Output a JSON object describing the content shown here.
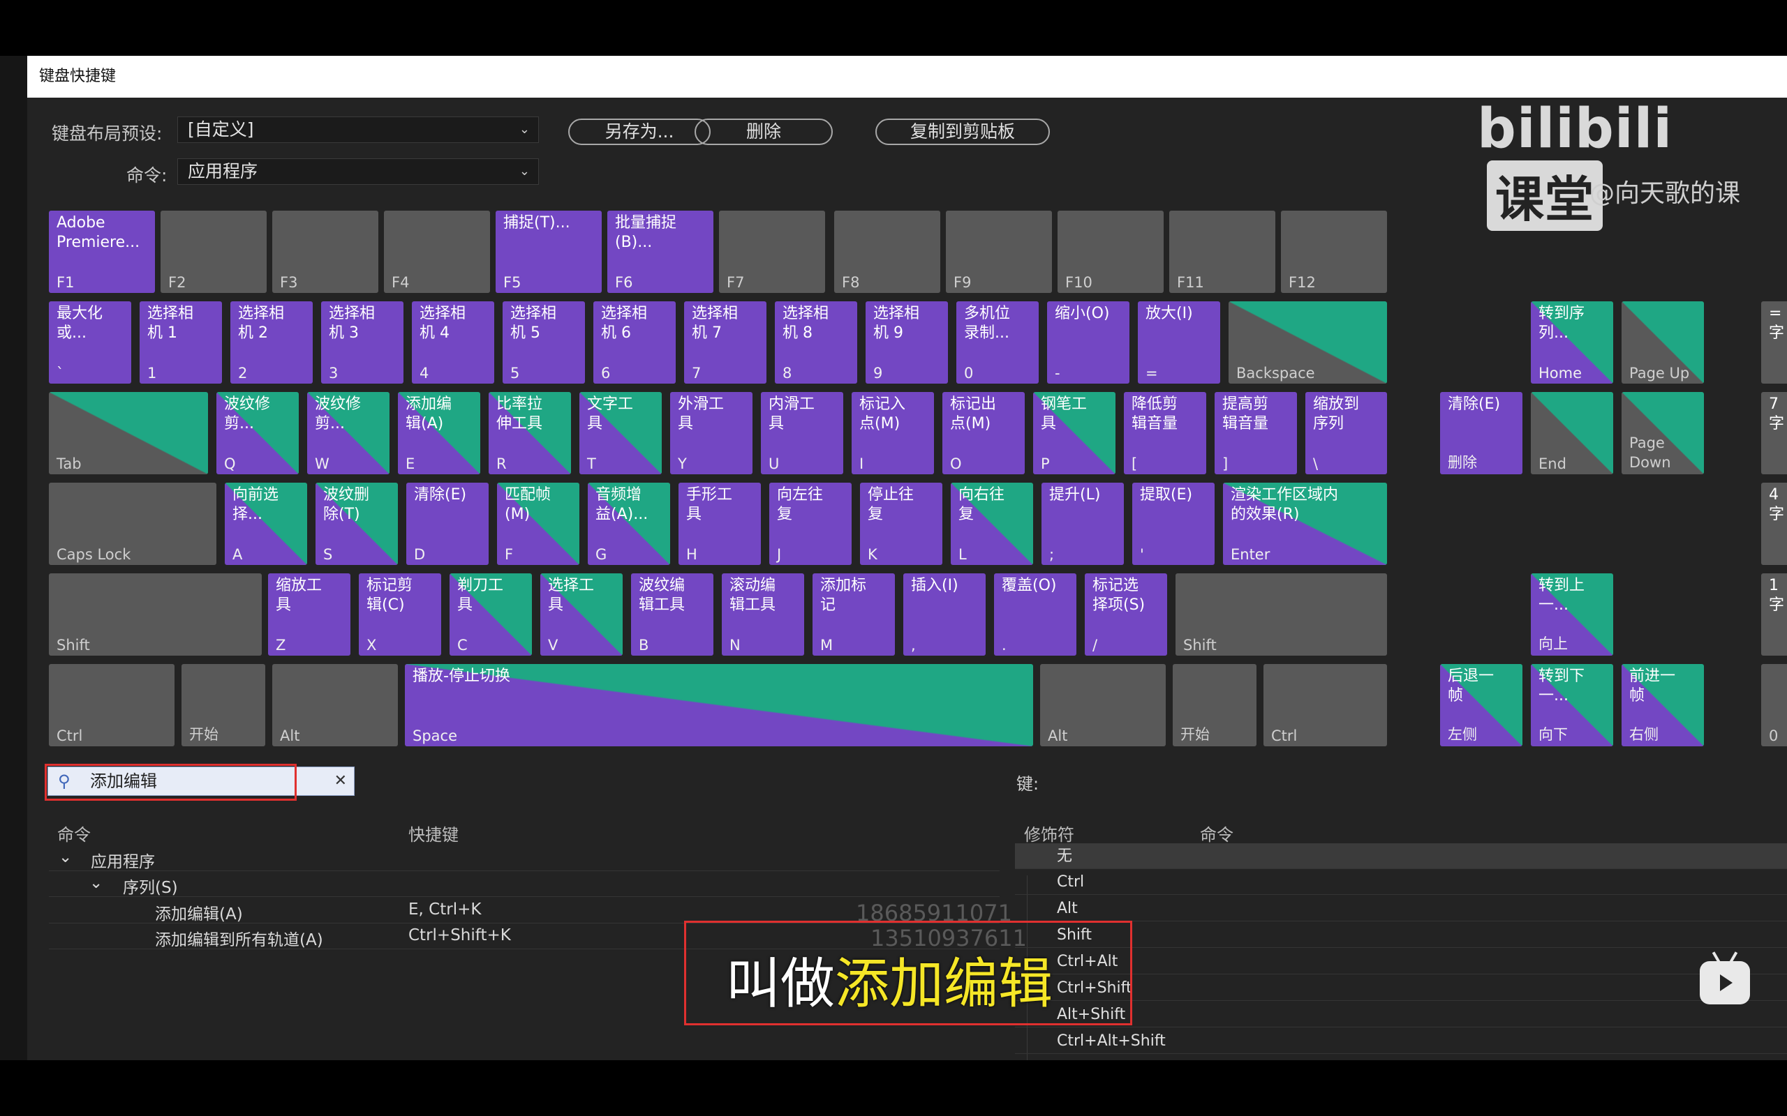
{
  "window_title": "键盘快捷键",
  "preset_label": "键盘布局预设:",
  "preset_value": "[自定义]",
  "command_label": "命令:",
  "command_value": "应用程序",
  "buttons": {
    "save_as": "另存为...",
    "delete": "删除",
    "copy": "复制到剪贴板"
  },
  "watermark": {
    "logo": "bilibili",
    "logo_box": "课堂",
    "user": "@向天歌的课"
  },
  "keys": [
    {
      "id": "f1",
      "type": "app",
      "cmd": "Adobe\nPremiere...",
      "lbl": "F1"
    },
    {
      "id": "f2",
      "type": "none",
      "cmd": "",
      "lbl": "F2"
    },
    {
      "id": "f3",
      "type": "none",
      "cmd": "",
      "lbl": "F3"
    },
    {
      "id": "f4",
      "type": "none",
      "cmd": "",
      "lbl": "F4"
    },
    {
      "id": "f5",
      "type": "app",
      "cmd": "捕捉(T)...",
      "lbl": "F5"
    },
    {
      "id": "f6",
      "type": "app",
      "cmd": "批量捕捉\n(B)...",
      "lbl": "F6"
    },
    {
      "id": "f7",
      "type": "none",
      "cmd": "",
      "lbl": "F7"
    },
    {
      "id": "f8",
      "type": "none",
      "cmd": "",
      "lbl": "F8"
    },
    {
      "id": "f9",
      "type": "none",
      "cmd": "",
      "lbl": "F9"
    },
    {
      "id": "f10",
      "type": "none",
      "cmd": "",
      "lbl": "F10"
    },
    {
      "id": "f11",
      "type": "none",
      "cmd": "",
      "lbl": "F11"
    },
    {
      "id": "f12",
      "type": "none",
      "cmd": "",
      "lbl": "F12"
    },
    {
      "id": "grave",
      "type": "app",
      "cmd": "最大化\n或...",
      "lbl": "`"
    },
    {
      "id": "1",
      "type": "app",
      "cmd": "选择相\n机 1",
      "lbl": "1"
    },
    {
      "id": "2",
      "type": "app",
      "cmd": "选择相\n机 2",
      "lbl": "2"
    },
    {
      "id": "3",
      "type": "app",
      "cmd": "选择相\n机 3",
      "lbl": "3"
    },
    {
      "id": "4",
      "type": "app",
      "cmd": "选择相\n机 4",
      "lbl": "4"
    },
    {
      "id": "5",
      "type": "app",
      "cmd": "选择相\n机 5",
      "lbl": "5"
    },
    {
      "id": "6",
      "type": "app",
      "cmd": "选择相\n机 6",
      "lbl": "6"
    },
    {
      "id": "7",
      "type": "app",
      "cmd": "选择相\n机 7",
      "lbl": "7"
    },
    {
      "id": "8",
      "type": "app",
      "cmd": "选择相\n机 8",
      "lbl": "8"
    },
    {
      "id": "9",
      "type": "app",
      "cmd": "选择相\n机 9",
      "lbl": "9"
    },
    {
      "id": "0",
      "type": "app",
      "cmd": "多机位\n录制...",
      "lbl": "0"
    },
    {
      "id": "minus",
      "type": "app",
      "cmd": "缩小(O)",
      "lbl": "-"
    },
    {
      "id": "equals",
      "type": "app",
      "cmd": "放大(I)",
      "lbl": "="
    },
    {
      "id": "backspace",
      "type": "seq",
      "cmd": "",
      "lbl": "Backspace"
    },
    {
      "id": "tab",
      "type": "seq",
      "cmd": "",
      "lbl": "Tab"
    },
    {
      "id": "q",
      "type": "pan",
      "cmd": "波纹修\n剪...",
      "lbl": "Q"
    },
    {
      "id": "w",
      "type": "pan",
      "cmd": "波纹修\n剪...",
      "lbl": "W"
    },
    {
      "id": "e",
      "type": "pan",
      "cmd": "添加编\n辑(A)",
      "lbl": "E"
    },
    {
      "id": "r",
      "type": "pan",
      "cmd": "比率拉\n伸工具",
      "lbl": "R"
    },
    {
      "id": "t",
      "type": "pan",
      "cmd": "文字工\n具",
      "lbl": "T"
    },
    {
      "id": "y",
      "type": "app",
      "cmd": "外滑工\n具",
      "lbl": "Y"
    },
    {
      "id": "u",
      "type": "app",
      "cmd": "内滑工\n具",
      "lbl": "U"
    },
    {
      "id": "i",
      "type": "app",
      "cmd": "标记入\n点(M)",
      "lbl": "I"
    },
    {
      "id": "o",
      "type": "app",
      "cmd": "标记出\n点(M)",
      "lbl": "O"
    },
    {
      "id": "p",
      "type": "pan",
      "cmd": "钢笔工\n具",
      "lbl": "P"
    },
    {
      "id": "lbracket",
      "type": "app",
      "cmd": "降低剪\n辑音量",
      "lbl": "["
    },
    {
      "id": "rbracket",
      "type": "app",
      "cmd": "提高剪\n辑音量",
      "lbl": "]"
    },
    {
      "id": "backslash",
      "type": "app",
      "cmd": "缩放到\n序列",
      "lbl": "\\"
    },
    {
      "id": "capslock",
      "type": "none",
      "cmd": "",
      "lbl": "Caps Lock"
    },
    {
      "id": "a",
      "type": "pan",
      "cmd": "向前选\n择...",
      "lbl": "A"
    },
    {
      "id": "s",
      "type": "pan",
      "cmd": "波纹删\n除(T)",
      "lbl": "S"
    },
    {
      "id": "d",
      "type": "app",
      "cmd": "清除(E)",
      "lbl": "D"
    },
    {
      "id": "f",
      "type": "pan",
      "cmd": "匹配帧\n(M)",
      "lbl": "F"
    },
    {
      "id": "g",
      "type": "pan",
      "cmd": "音频增\n益(A)...",
      "lbl": "G"
    },
    {
      "id": "h",
      "type": "app",
      "cmd": "手形工\n具",
      "lbl": "H"
    },
    {
      "id": "j",
      "type": "app",
      "cmd": "向左往\n复",
      "lbl": "J"
    },
    {
      "id": "k",
      "type": "app",
      "cmd": "停止往\n复",
      "lbl": "K"
    },
    {
      "id": "l",
      "type": "pan",
      "cmd": "向右往\n复",
      "lbl": "L"
    },
    {
      "id": "semicolon",
      "type": "app",
      "cmd": "提升(L)",
      "lbl": ";"
    },
    {
      "id": "quote",
      "type": "app",
      "cmd": "提取(E)",
      "lbl": "'"
    },
    {
      "id": "enter",
      "type": "pan",
      "cmd": "渲染工作区域内\n的效果(R)",
      "lbl": "Enter"
    },
    {
      "id": "lshift",
      "type": "none",
      "cmd": "",
      "lbl": "Shift"
    },
    {
      "id": "z",
      "type": "app",
      "cmd": "缩放工\n具",
      "lbl": "Z"
    },
    {
      "id": "x",
      "type": "app",
      "cmd": "标记剪\n辑(C)",
      "lbl": "X"
    },
    {
      "id": "c",
      "type": "pan",
      "cmd": "剃刀工\n具",
      "lbl": "C"
    },
    {
      "id": "v",
      "type": "pan",
      "cmd": "选择工\n具",
      "lbl": "V"
    },
    {
      "id": "b",
      "type": "app",
      "cmd": "波纹编\n辑工具",
      "lbl": "B"
    },
    {
      "id": "n",
      "type": "app",
      "cmd": "滚动编\n辑工具",
      "lbl": "N"
    },
    {
      "id": "m",
      "type": "app",
      "cmd": "添加标\n记",
      "lbl": "M"
    },
    {
      "id": "comma",
      "type": "app",
      "cmd": "插入(I)",
      "lbl": ","
    },
    {
      "id": "period",
      "type": "app",
      "cmd": "覆盖(O)",
      "lbl": "."
    },
    {
      "id": "slash",
      "type": "app",
      "cmd": "标记选\n择项(S)",
      "lbl": "/"
    },
    {
      "id": "rshift",
      "type": "none",
      "cmd": "",
      "lbl": "Shift"
    },
    {
      "id": "lctrl",
      "type": "none",
      "cmd": "",
      "lbl": "Ctrl"
    },
    {
      "id": "lwin",
      "type": "none",
      "cmd": "",
      "lbl": "开始"
    },
    {
      "id": "lalt",
      "type": "none",
      "cmd": "",
      "lbl": "Alt"
    },
    {
      "id": "space",
      "type": "pan",
      "cmd": "播放-停止切换",
      "lbl": "Space"
    },
    {
      "id": "ralt",
      "type": "none",
      "cmd": "",
      "lbl": "Alt"
    },
    {
      "id": "rwin",
      "type": "none",
      "cmd": "",
      "lbl": "开始"
    },
    {
      "id": "rctrl",
      "type": "none",
      "cmd": "",
      "lbl": "Ctrl"
    },
    {
      "id": "home",
      "type": "pan",
      "cmd": "转到序\n列...",
      "lbl": "Home"
    },
    {
      "id": "pageup",
      "type": "seq",
      "cmd": "",
      "lbl": "Page Up"
    },
    {
      "id": "delete",
      "type": "app",
      "cmd": "清除(E)",
      "lbl": "删除"
    },
    {
      "id": "end",
      "type": "seq",
      "cmd": "",
      "lbl": "End"
    },
    {
      "id": "pagedown",
      "type": "seq",
      "cmd": "",
      "lbl": "Page\nDown"
    },
    {
      "id": "up",
      "type": "pan",
      "cmd": "转到上\n一...",
      "lbl": "向上"
    },
    {
      "id": "left",
      "type": "pan",
      "cmd": "后退一\n帧",
      "lbl": "左侧"
    },
    {
      "id": "down",
      "type": "pan",
      "cmd": "转到下\n一...",
      "lbl": "向下"
    },
    {
      "id": "right",
      "type": "pan",
      "cmd": "前进一\n帧",
      "lbl": "右侧"
    },
    {
      "id": "np1",
      "type": "none",
      "cmd": "=\n字",
      "lbl": ""
    },
    {
      "id": "np2",
      "type": "none",
      "cmd": "7\n字",
      "lbl": ""
    },
    {
      "id": "np3",
      "type": "none",
      "cmd": "4\n字",
      "lbl": ""
    },
    {
      "id": "np4",
      "type": "none",
      "cmd": "1\n字",
      "lbl": ""
    },
    {
      "id": "np5",
      "type": "none",
      "cmd": "",
      "lbl": "0"
    }
  ],
  "search": {
    "value": "添加编辑"
  },
  "key_label": "键:",
  "table": {
    "headers": {
      "command": "命令",
      "shortcut": "快捷键"
    },
    "group": "应用程序",
    "subgroup": "序列(S)",
    "rows": [
      {
        "command": "添加编辑(A)",
        "shortcut": "E, Ctrl+K"
      },
      {
        "command": "添加编辑到所有轨道(A)",
        "shortcut": "Ctrl+Shift+K"
      }
    ]
  },
  "modifier_table": {
    "headers": {
      "modifier": "修饰符",
      "command": "命令"
    },
    "rows": [
      "无",
      "Ctrl",
      "Alt",
      "Shift",
      "Ctrl+Alt",
      "Ctrl+Shift",
      "Alt+Shift",
      "Ctrl+Alt+Shift"
    ]
  },
  "ghost_numbers": [
    "18685911071",
    "13510937611"
  ],
  "subtitle": {
    "prefix": "叫做",
    "highlight": "添加编辑"
  },
  "colors": {
    "application": "#7347c3",
    "panel": "#1fa784",
    "unassigned": "#595959",
    "highlight_box": "#e0302f",
    "subtitle_highlight": "#f5e627"
  }
}
